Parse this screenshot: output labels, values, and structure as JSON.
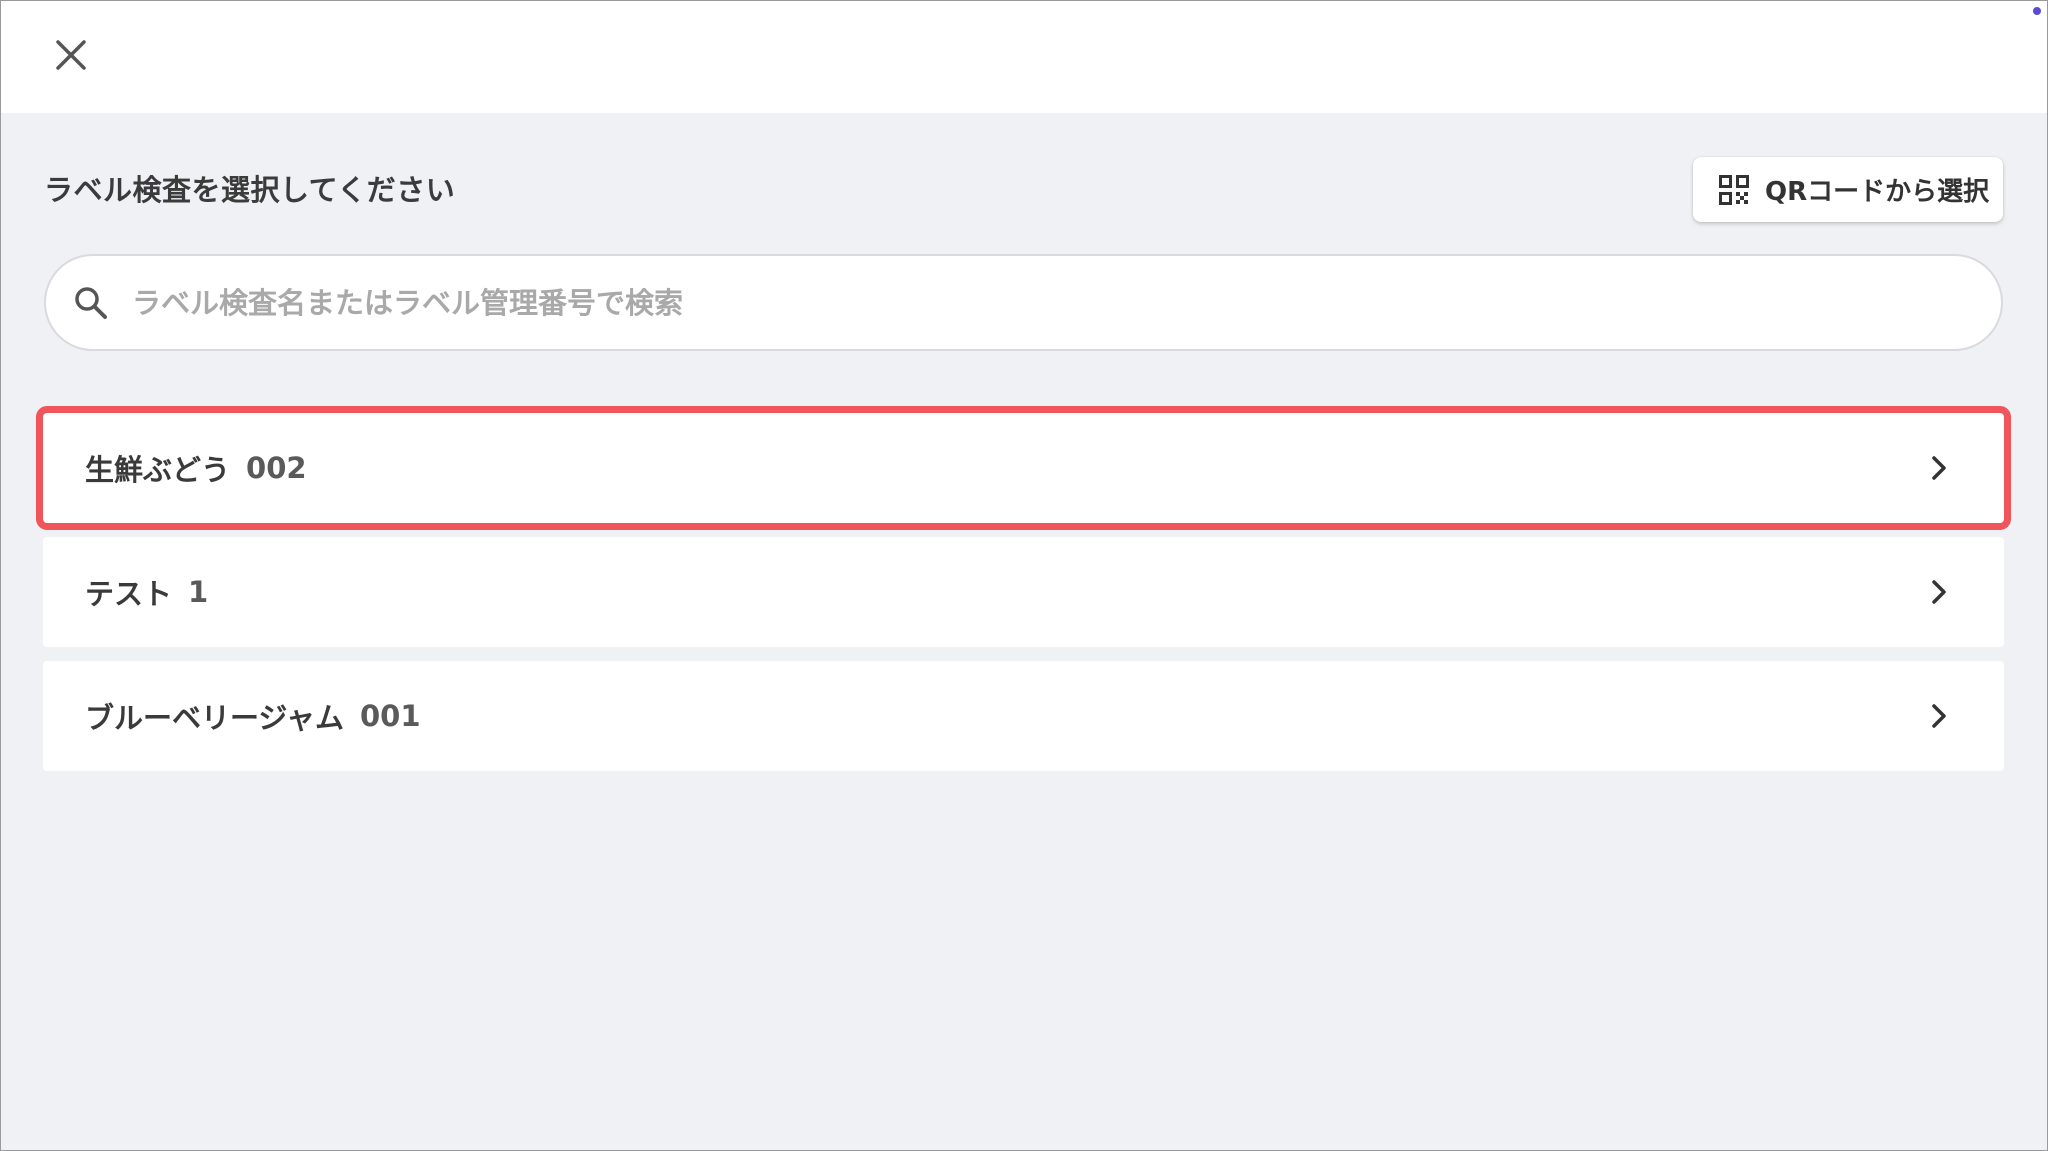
{
  "header": {
    "close_icon": "close-icon"
  },
  "page": {
    "heading": "ラベル検査を選択してください"
  },
  "qr_button": {
    "label": "QRコードから選択",
    "icon": "qr-code-icon"
  },
  "search": {
    "placeholder": "ラベル検査名またはラベル管理番号で検索",
    "value": "",
    "icon": "search-icon"
  },
  "items": [
    {
      "name": "生鮮ぶどう",
      "number": "002",
      "highlighted": true
    },
    {
      "name": "テスト",
      "number": "1",
      "highlighted": false
    },
    {
      "name": "ブルーベリージャム",
      "number": "001",
      "highlighted": false
    }
  ],
  "colors": {
    "background": "#f0f1f5",
    "highlight_border": "#f0555b",
    "status_dot": "#5b4bdb"
  }
}
